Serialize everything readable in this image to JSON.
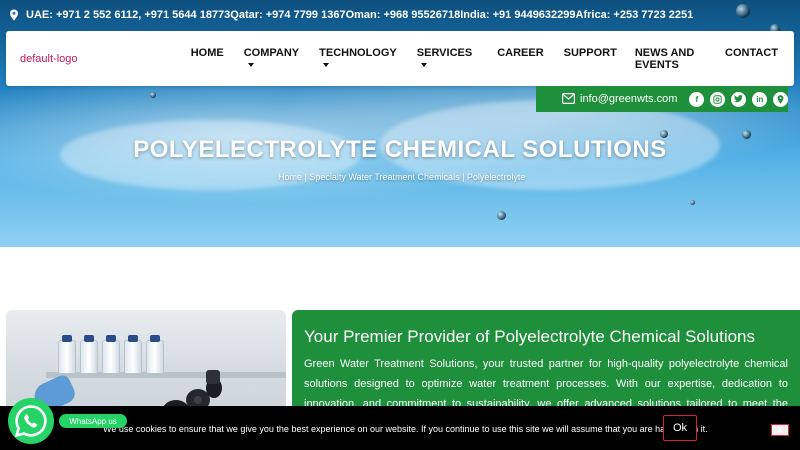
{
  "topbar": {
    "contacts": "UAE: +971 2 552 6112, +971 5644 18773Qatar: +974 7799 1367Oman: +968 95526718India: +91 9449632299Africa: +253 7723 2251"
  },
  "header": {
    "logo_text": "default-logo",
    "nav": {
      "home": "HOME",
      "company": "COMPANY",
      "technology": "TECHNOLOGY",
      "services": "SERVICES",
      "career": "CAREER",
      "support": "SUPPORT",
      "news": "NEWS AND EVENTS",
      "contact": "CONTACT"
    }
  },
  "contact_strip": {
    "email": "info@greenwts.com",
    "socials": [
      "facebook-icon",
      "instagram-icon",
      "twitter-icon",
      "linkedin-icon",
      "location-icon"
    ]
  },
  "hero": {
    "title": "POLYELECTROLYTE CHEMICAL SOLUTIONS",
    "breadcrumb": "Home | Specialty Water Treatment Chemicals | Polyelectrolyte"
  },
  "intro": {
    "heading": "Your Premier Provider of Polyelectrolyte Chemical Solutions",
    "body": "Green Water Treatment Solutions, your trusted partner for high-quality polyelectrolyte chemical solutions designed to optimize water treatment processes. With our expertise, dedication to innovation, and commitment to sustainability, we offer advanced solutions tailored to meet the diverse needs of our clients."
  },
  "cookie": {
    "message": "We use cookies to ensure that we give you the best experience on our website. If you continue to use this site we will assume that you are happy with it.",
    "ok_label": "Ok",
    "close_label": "✕"
  },
  "whatsapp": {
    "label": "WhatsApp us"
  },
  "colors": {
    "brand_green": "#1e8f3a",
    "whatsapp_green": "#25d366",
    "logo_text": "#c2185b",
    "cookie_accent": "#d0243f"
  }
}
